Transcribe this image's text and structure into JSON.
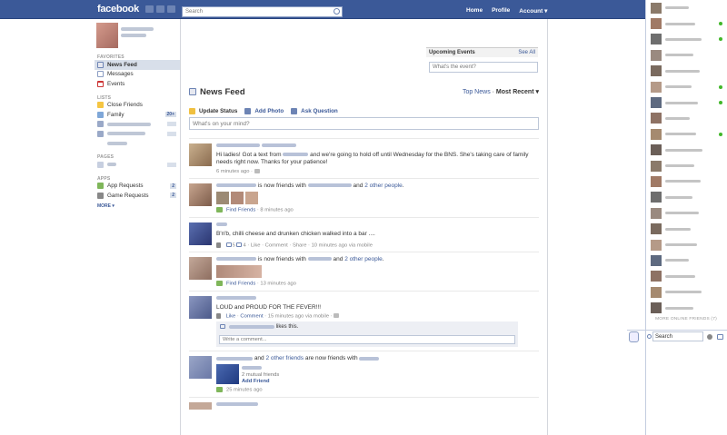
{
  "header": {
    "logo": "facebook",
    "search_placeholder": "Search",
    "nav": {
      "home": "Home",
      "profile": "Profile",
      "account": "Account ▾"
    }
  },
  "left_nav": {
    "favorites_heading": "FAVORITES",
    "favorites": [
      {
        "label": "News Feed",
        "icon": "news-feed-icon"
      },
      {
        "label": "Messages",
        "icon": "messages-icon"
      },
      {
        "label": "Events",
        "icon": "events-icon"
      }
    ],
    "lists_heading": "LISTS",
    "lists": [
      {
        "label": "Close Friends",
        "count": ""
      },
      {
        "label": "Family",
        "count": "20+"
      }
    ],
    "pages_heading": "PAGES",
    "apps_heading": "APPS",
    "apps": [
      {
        "label": "App Requests",
        "count": "2"
      },
      {
        "label": "Game Requests",
        "count": "2"
      }
    ],
    "more": "MORE ▾"
  },
  "feed": {
    "title": "News Feed",
    "sort": {
      "top_news": "Top News",
      "sep": " · ",
      "most_recent": "Most Recent ▾"
    },
    "publisher": {
      "update_status": "Update Status",
      "add_photo": "Add Photo",
      "ask_question": "Ask Question",
      "input_placeholder": "What's on your mind?"
    },
    "stories": [
      {
        "text_a": "Hi ladies! Got a text from",
        "text_b": "and we're going to hold off until Wednesday for the BNS. She's taking care of family needs right now. Thanks for your patience!",
        "meta": "6 minutes ago · "
      },
      {
        "text_a": "is now friends with",
        "text_b": "and",
        "link": "2 other people",
        "action": "Find Friends",
        "meta": " · 8 minutes ago"
      },
      {
        "text": "B'n'b, chilli cheese and drunken chicken walked into a bar ....",
        "comments": "5",
        "likes": "4",
        "actions": " · Like · Comment · Share · 10 minutes ago via mobile"
      },
      {
        "text_a": "is now friends with",
        "text_b": "and",
        "link": "2 other people",
        "action": "Find Friends",
        "meta": " · 13 minutes ago"
      },
      {
        "text": "LOUD and PROUD FOR THE FEVER!!!",
        "actions_a": "Like",
        "actions_b": "Comment",
        "meta": " · 15 minutes ago via mobile · ",
        "likes_text": "likes this.",
        "comment_placeholder": "Write a comment..."
      },
      {
        "text_a": "and",
        "link": "2 other friends",
        "text_b": "are now friends with",
        "mutual": "2 mutual friends",
        "add_friend": "Add Friend",
        "meta": "25 minutes ago"
      }
    ]
  },
  "events": {
    "title": "Upcoming Events",
    "see_all": "See All",
    "placeholder": "What's the event?"
  },
  "chat": {
    "more_online": "MORE ONLINE FRIENDS (7)",
    "search": "Search",
    "online_flags": [
      false,
      true,
      true,
      false,
      false,
      true,
      true,
      false,
      true,
      false,
      false,
      false,
      false,
      false,
      false,
      false,
      false,
      false,
      false,
      false
    ]
  },
  "colors": {
    "brand": "#3b5998",
    "online": "#42b72a"
  }
}
